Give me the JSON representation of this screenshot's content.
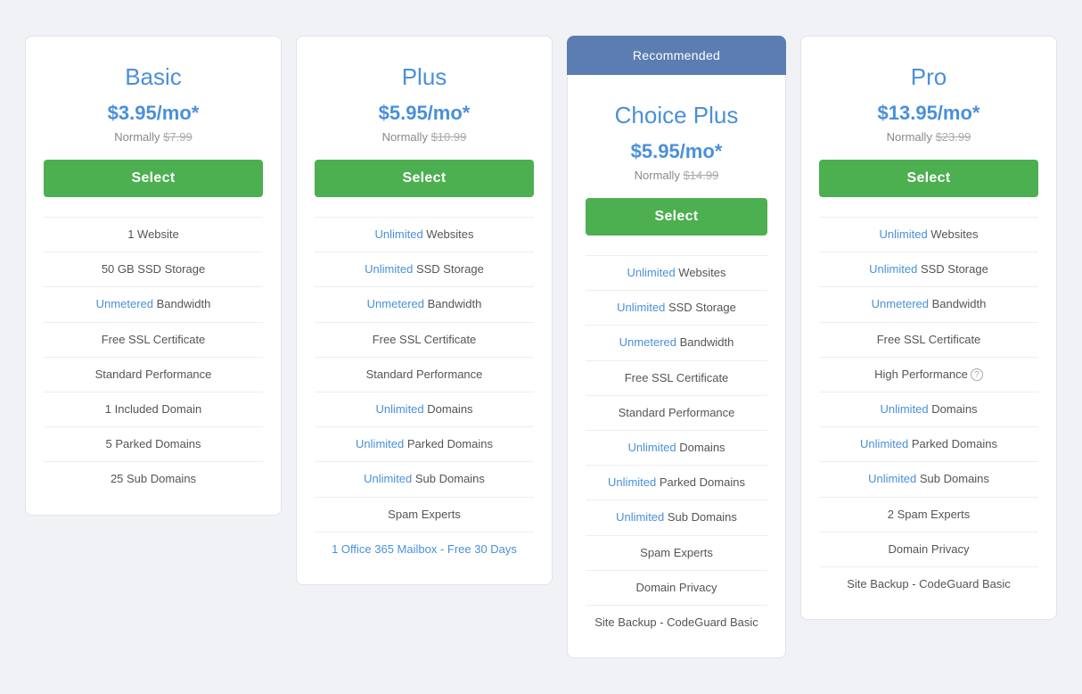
{
  "plans": [
    {
      "id": "basic",
      "name": "Basic",
      "price": "$3.95/mo*",
      "normal_price": "$7.99",
      "select_label": "Select",
      "recommended": false,
      "features": [
        {
          "text": "1 Website",
          "highlight": null
        },
        {
          "text": "50 GB SSD Storage",
          "highlight": null
        },
        {
          "text": "Bandwidth",
          "highlight": "Unmetered"
        },
        {
          "text": "Free SSL Certificate",
          "highlight": null
        },
        {
          "text": "Standard Performance",
          "highlight": null
        },
        {
          "text": "1 Included Domain",
          "highlight": null
        },
        {
          "text": "5 Parked Domains",
          "highlight": null
        },
        {
          "text": "25 Sub Domains",
          "highlight": null
        }
      ]
    },
    {
      "id": "plus",
      "name": "Plus",
      "price": "$5.95/mo*",
      "normal_price": "$10.99",
      "select_label": "Select",
      "recommended": false,
      "features": [
        {
          "text": "Websites",
          "highlight": "Unlimited"
        },
        {
          "text": "SSD Storage",
          "highlight": "Unlimited"
        },
        {
          "text": "Bandwidth",
          "highlight": "Unmetered"
        },
        {
          "text": "Free SSL Certificate",
          "highlight": null
        },
        {
          "text": "Standard Performance",
          "highlight": null
        },
        {
          "text": "Domains",
          "highlight": "Unlimited"
        },
        {
          "text": "Parked Domains",
          "highlight": "Unlimited"
        },
        {
          "text": "Sub Domains",
          "highlight": "Unlimited"
        },
        {
          "text": "Spam Experts",
          "highlight": null
        },
        {
          "text": "1 Office 365 Mailbox - Free 30 Days",
          "highlight": "link"
        }
      ]
    },
    {
      "id": "choice-plus",
      "name": "Choice Plus",
      "price": "$5.95/mo*",
      "normal_price": "$14.99",
      "select_label": "Select",
      "recommended": true,
      "recommended_label": "Recommended",
      "features": [
        {
          "text": "Websites",
          "highlight": "Unlimited"
        },
        {
          "text": "SSD Storage",
          "highlight": "Unlimited"
        },
        {
          "text": "Bandwidth",
          "highlight": "Unmetered"
        },
        {
          "text": "Free SSL Certificate",
          "highlight": null
        },
        {
          "text": "Standard Performance",
          "highlight": null
        },
        {
          "text": "Domains",
          "highlight": "Unlimited"
        },
        {
          "text": "Parked Domains",
          "highlight": "Unlimited"
        },
        {
          "text": "Sub Domains",
          "highlight": "Unlimited"
        },
        {
          "text": "Spam Experts",
          "highlight": null
        },
        {
          "text": "Domain Privacy",
          "highlight": null
        },
        {
          "text": "Site Backup - CodeGuard Basic",
          "highlight": null
        }
      ]
    },
    {
      "id": "pro",
      "name": "Pro",
      "price": "$13.95/mo*",
      "normal_price": "$23.99",
      "select_label": "Select",
      "recommended": false,
      "features": [
        {
          "text": "Websites",
          "highlight": "Unlimited"
        },
        {
          "text": "SSD Storage",
          "highlight": "Unlimited"
        },
        {
          "text": "Bandwidth",
          "highlight": "Unmetered"
        },
        {
          "text": "Free SSL Certificate",
          "highlight": null
        },
        {
          "text": "High Performance",
          "highlight": null,
          "help": true
        },
        {
          "text": "Domains",
          "highlight": "Unlimited"
        },
        {
          "text": "Parked Domains",
          "highlight": "Unlimited"
        },
        {
          "text": "Sub Domains",
          "highlight": "Unlimited"
        },
        {
          "text": "2 Spam Experts",
          "highlight": null
        },
        {
          "text": "Domain Privacy",
          "highlight": null
        },
        {
          "text": "Site Backup - CodeGuard Basic",
          "highlight": null
        }
      ]
    }
  ],
  "normally_label": "Normally"
}
